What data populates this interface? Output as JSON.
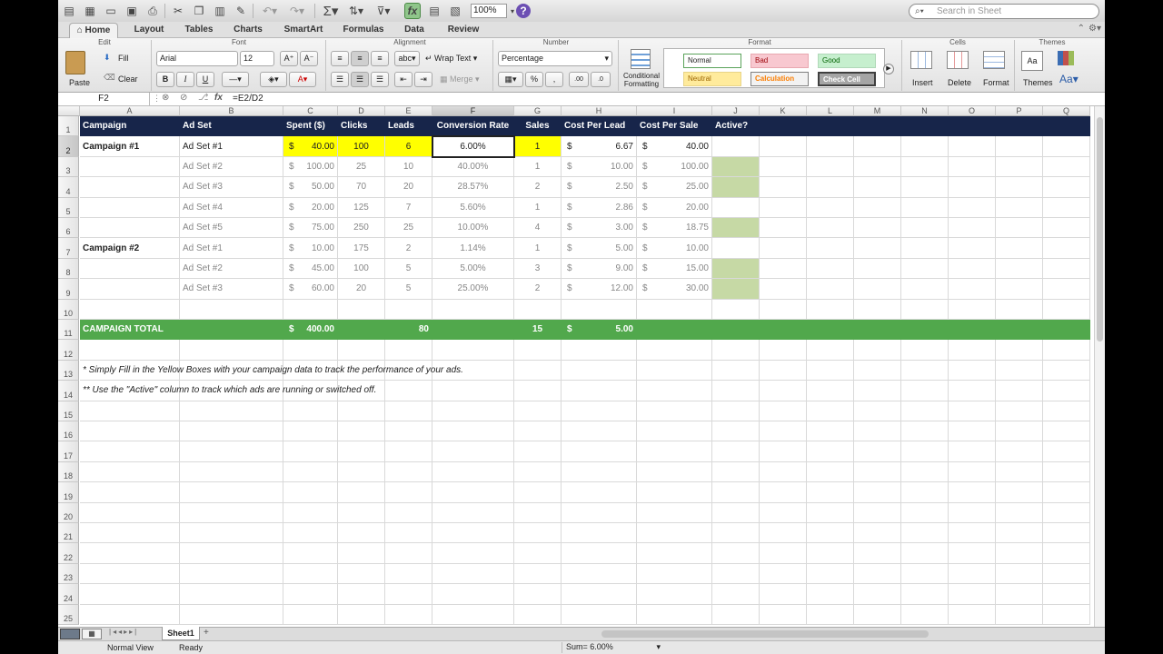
{
  "toolbar": {
    "zoom": "100%",
    "search_placeholder": "Search in Sheet",
    "icons": [
      "new-icon",
      "gallery-icon",
      "open-icon",
      "save-icon",
      "print-icon",
      "cut-icon",
      "copy-icon",
      "paste-icon",
      "format-painter-icon",
      "undo-icon",
      "redo-icon",
      "autosum-icon",
      "sort-icon",
      "filter-icon",
      "function-icon",
      "gallery-view-icon",
      "toolbox-icon",
      "help-icon"
    ]
  },
  "ribbon_tabs": [
    "Home",
    "Layout",
    "Tables",
    "Charts",
    "SmartArt",
    "Formulas",
    "Data",
    "Review"
  ],
  "ribbon": {
    "groups": {
      "edit": "Edit",
      "font": "Font",
      "alignment": "Alignment",
      "number": "Number",
      "format": "Format",
      "cells": "Cells",
      "themes": "Themes"
    },
    "paste": "Paste",
    "fill": "Fill",
    "clear": "Clear",
    "font_name": "Arial",
    "font_size": "12",
    "bold": "B",
    "italic": "I",
    "underline": "U",
    "wrap_text": "Wrap Text",
    "merge": "Merge",
    "abc": "abc",
    "number_format": "Percentage",
    "conditional_formatting": "Conditional Formatting",
    "styles": {
      "normal": "Normal",
      "bad": "Bad",
      "good": "Good",
      "neutral": "Neutral",
      "calculation": "Calculation",
      "check_cell": "Check Cell"
    },
    "insert": "Insert",
    "delete": "Delete",
    "format": "Format",
    "themes_btn": "Themes",
    "aa": "Aa"
  },
  "formula_bar": {
    "cell_ref": "F2",
    "fx": "fx",
    "formula": "=E2/D2"
  },
  "columns": [
    "A",
    "B",
    "C",
    "D",
    "E",
    "F",
    "G",
    "H",
    "I",
    "J",
    "K",
    "L",
    "M",
    "N",
    "O",
    "P",
    "Q"
  ],
  "rows": [
    "1",
    "2",
    "3",
    "4",
    "5",
    "6",
    "7",
    "8",
    "9",
    "10",
    "11",
    "12",
    "13",
    "14",
    "15",
    "16",
    "17",
    "18",
    "19",
    "20",
    "21",
    "22",
    "23",
    "24",
    "25"
  ],
  "table": {
    "headers": [
      "Campaign",
      "Ad Set",
      "Spent ($)",
      "Clicks",
      "Leads",
      "Conversion Rate",
      "Sales",
      "Cost Per Lead",
      "Cost Per Sale",
      "Active?"
    ],
    "currency": "$",
    "data_rows": [
      {
        "campaign": "Campaign #1",
        "adset": "Ad Set #1",
        "spent": "40.00",
        "clicks": "100",
        "leads": "6",
        "conv": "6.00%",
        "sales": "1",
        "cpl": "6.67",
        "cps": "40.00",
        "active": false
      },
      {
        "campaign": "",
        "adset": "Ad Set #2",
        "spent": "100.00",
        "clicks": "25",
        "leads": "10",
        "conv": "40.00%",
        "sales": "1",
        "cpl": "10.00",
        "cps": "100.00",
        "active": true
      },
      {
        "campaign": "",
        "adset": "Ad Set #3",
        "spent": "50.00",
        "clicks": "70",
        "leads": "20",
        "conv": "28.57%",
        "sales": "2",
        "cpl": "2.50",
        "cps": "25.00",
        "active": true
      },
      {
        "campaign": "",
        "adset": "Ad Set #4",
        "spent": "20.00",
        "clicks": "125",
        "leads": "7",
        "conv": "5.60%",
        "sales": "1",
        "cpl": "2.86",
        "cps": "20.00",
        "active": false
      },
      {
        "campaign": "",
        "adset": "Ad Set #5",
        "spent": "75.00",
        "clicks": "250",
        "leads": "25",
        "conv": "10.00%",
        "sales": "4",
        "cpl": "3.00",
        "cps": "18.75",
        "active": true
      },
      {
        "campaign": "Campaign #2",
        "adset": "Ad Set #1",
        "spent": "10.00",
        "clicks": "175",
        "leads": "2",
        "conv": "1.14%",
        "sales": "1",
        "cpl": "5.00",
        "cps": "10.00",
        "active": false
      },
      {
        "campaign": "",
        "adset": "Ad Set #2",
        "spent": "45.00",
        "clicks": "100",
        "leads": "5",
        "conv": "5.00%",
        "sales": "3",
        "cpl": "9.00",
        "cps": "15.00",
        "active": true
      },
      {
        "campaign": "",
        "adset": "Ad Set #3",
        "spent": "60.00",
        "clicks": "20",
        "leads": "5",
        "conv": "25.00%",
        "sales": "2",
        "cpl": "12.00",
        "cps": "30.00",
        "active": true
      }
    ],
    "total": {
      "label": "CAMPAIGN TOTAL",
      "spent": "400.00",
      "leads": "80",
      "sales": "15",
      "cpl": "5.00"
    },
    "notes": [
      "* Simply Fill in the Yellow Boxes with your campaign data to track the performance of your ads.",
      "** Use the \"Active\" column to track which ads are running or switched off."
    ]
  },
  "sheet_tabs": [
    "Sheet1"
  ],
  "status": {
    "view": "Normal View",
    "state": "Ready",
    "sum": "Sum= 6.00%"
  },
  "colors": {
    "header_bg": "#17254a",
    "total_bg": "#51a84c",
    "input_yellow": "#ffff00",
    "active_green": "#c6d9a5"
  }
}
